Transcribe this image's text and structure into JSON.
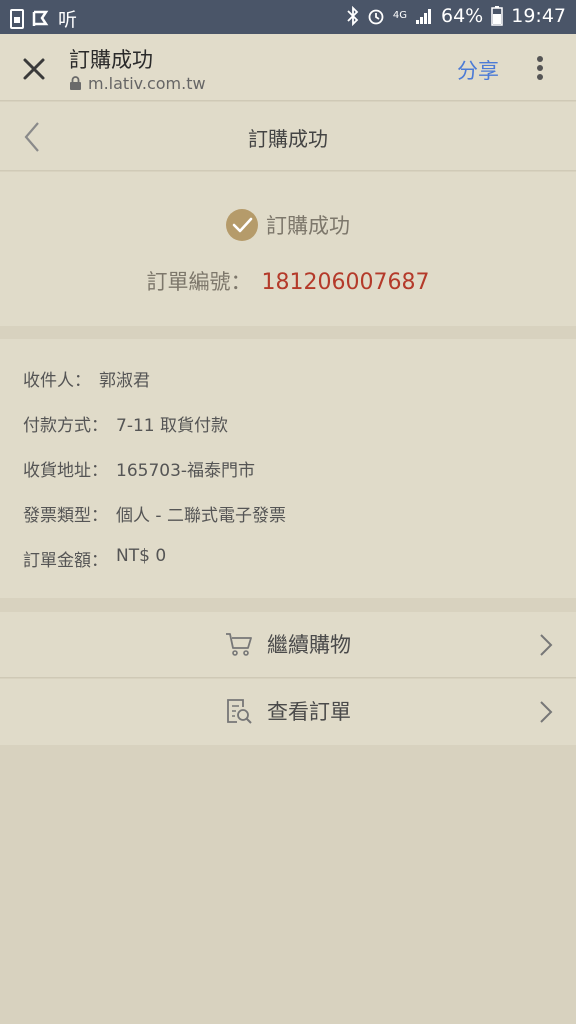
{
  "status_bar": {
    "app_text": "听",
    "battery": "64%",
    "time": "19:47",
    "network": "4G"
  },
  "browser": {
    "title": "訂購成功",
    "url": "m.lativ.com.tw",
    "share_label": "分享"
  },
  "header": {
    "title": "訂購成功"
  },
  "success": {
    "message": "訂購成功",
    "order_label": "訂單編號：",
    "order_number": "181206007687"
  },
  "info": {
    "rows": [
      {
        "label": "收件人：",
        "value": "郭淑君"
      },
      {
        "label": "付款方式：",
        "value": "7-11 取貨付款"
      },
      {
        "label": "收貨地址：",
        "value": "165703-福泰門市"
      },
      {
        "label": "發票類型：",
        "value": "個人 - 二聯式電子發票"
      },
      {
        "label": "訂單金額：",
        "value": "NT$ 0"
      }
    ]
  },
  "actions": {
    "continue_shopping": "繼續購物",
    "view_orders": "查看訂單"
  },
  "colors": {
    "accent_blue": "#4c7bd6",
    "order_red": "#b43a2a",
    "check_gold": "#b59b6a",
    "page_bg": "#d8d2bf",
    "card_bg": "#e0dbc9"
  }
}
